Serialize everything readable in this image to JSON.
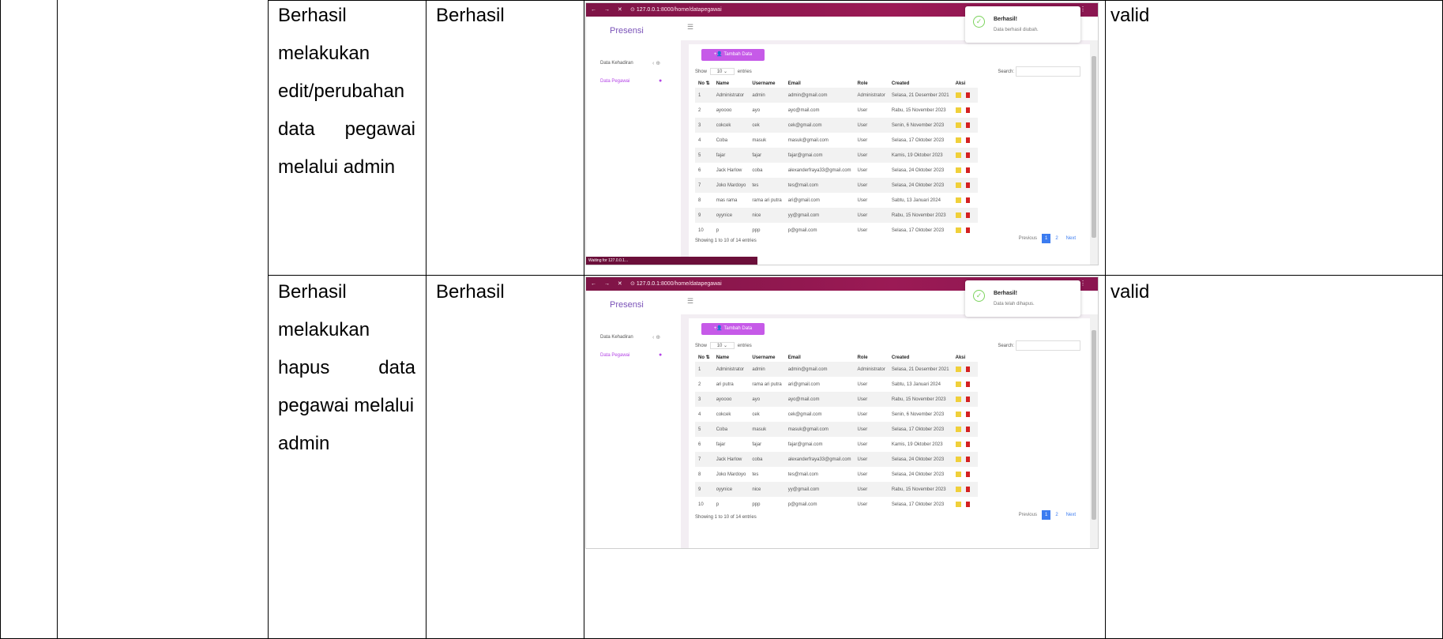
{
  "rows": [
    {
      "description_lines": [
        "Berhasil",
        "melakukan",
        "edit/perubahan",
        [
          "data",
          "pegawai"
        ],
        "melalui admin"
      ],
      "result": "Berhasil",
      "status": "valid",
      "screenshot": {
        "browser": {
          "url_host": "127.0.0.1",
          "url_path": ":8000/home/datapegawai",
          "loading_status": "Waiting for 127.0.0.1..."
        },
        "toast": {
          "title": "Berhasil!",
          "message": "Data berhasil diubah."
        },
        "rows": [
          [
            "1",
            "Administrator",
            "admin",
            "admin@gmail.com",
            "Administrator",
            "Selasa, 21 Desember 2021"
          ],
          [
            "2",
            "ayoooo",
            "ayo",
            "ayo@mail.com",
            "User",
            "Rabu, 15 November 2023"
          ],
          [
            "3",
            "cokcek",
            "cek",
            "cek@gmail.com",
            "User",
            "Senin, 6 November 2023"
          ],
          [
            "4",
            "Coba",
            "masuk",
            "masuk@gmail.com",
            "User",
            "Selasa, 17 Oktober 2023"
          ],
          [
            "5",
            "fajar",
            "fajar",
            "fajar@gmai.com",
            "User",
            "Kamis, 19 Oktober 2023"
          ],
          [
            "6",
            "Jack Harlow",
            "coba",
            "alexanderfraya33@gmail.com",
            "User",
            "Selasa, 24 Oktober 2023"
          ],
          [
            "7",
            "Joko Mardoyo",
            "tes",
            "tes@mail.com",
            "User",
            "Selasa, 24 Oktober 2023"
          ],
          [
            "8",
            "mas rama",
            "rama ari putra",
            "ari@gmail.com",
            "User",
            "Sabtu, 13 Januari 2024"
          ],
          [
            "9",
            "oyynice",
            "nice",
            "yy@gmail.com",
            "User",
            "Rabu, 15 November 2023"
          ],
          [
            "10",
            "p",
            "ppp",
            "p@gmail.com",
            "User",
            "Selasa, 17 Oktober 2023"
          ]
        ]
      }
    },
    {
      "description_lines": [
        "Berhasil",
        "melakukan",
        [
          "hapus",
          "data"
        ],
        "pegawai melalui",
        "admin"
      ],
      "result": "Berhasil",
      "status": "valid",
      "screenshot": {
        "browser": {
          "url_host": "127.0.0.1",
          "url_path": ":8000/home/datapegawai",
          "loading_status": ""
        },
        "toast": {
          "title": "Berhasil!",
          "message": "Data telah dihapus."
        },
        "rows": [
          [
            "1",
            "Administrator",
            "admin",
            "admin@gmail.com",
            "Administrator",
            "Selasa, 21 Desember 2021"
          ],
          [
            "2",
            "ari putra",
            "rama ari putra",
            "ari@gmail.com",
            "User",
            "Sabtu, 13 Januari 2024"
          ],
          [
            "3",
            "ayoooo",
            "ayo",
            "ayo@mail.com",
            "User",
            "Rabu, 15 November 2023"
          ],
          [
            "4",
            "cokcek",
            "cek",
            "cek@gmail.com",
            "User",
            "Senin, 6 November 2023"
          ],
          [
            "5",
            "Coba",
            "masuk",
            "masuk@gmail.com",
            "User",
            "Selasa, 17 Oktober 2023"
          ],
          [
            "6",
            "fajar",
            "fajar",
            "fajar@gmai.com",
            "User",
            "Kamis, 19 Oktober 2023"
          ],
          [
            "7",
            "Jack Harlow",
            "coba",
            "alexanderfraya33@gmail.com",
            "User",
            "Selasa, 24 Oktober 2023"
          ],
          [
            "8",
            "Joko Mardoyo",
            "tes",
            "tes@mail.com",
            "User",
            "Selasa, 24 Oktober 2023"
          ],
          [
            "9",
            "oyynice",
            "nice",
            "yy@gmail.com",
            "User",
            "Rabu, 15 November 2023"
          ],
          [
            "10",
            "p",
            "ppp",
            "p@gmail.com",
            "User",
            "Selasa, 17 Oktober 2023"
          ]
        ]
      }
    }
  ],
  "app": {
    "brand": "Presensi",
    "menu": [
      "Data Kehadiran",
      "Data Pegawai"
    ],
    "add_button": "Tambah Data",
    "show_prefix": "Show",
    "show_value": "10",
    "show_suffix": "entries",
    "search_label": "Search:",
    "columns": [
      "No",
      "Name",
      "Username",
      "Email",
      "Role",
      "Created",
      "Aksi"
    ],
    "footer": "Showing 1 to 10 of 14 entries",
    "pager": [
      "Previous",
      "1",
      "2",
      "Next"
    ]
  },
  "colors": {
    "tabbar": "#8a1650",
    "accent": "#c65ae8",
    "page_link": "#3c7cf0",
    "edit": "#f0d03a",
    "delete": "#d42020"
  }
}
